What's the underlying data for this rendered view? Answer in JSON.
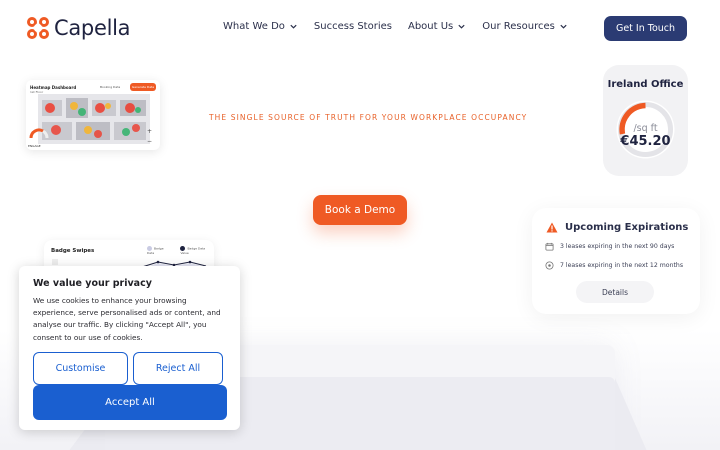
{
  "header": {
    "brand": "Capella",
    "nav": [
      {
        "label": "What We Do",
        "has_dropdown": true
      },
      {
        "label": "Success Stories",
        "has_dropdown": false
      },
      {
        "label": "About Us",
        "has_dropdown": true
      },
      {
        "label": "Our Resources",
        "has_dropdown": true
      }
    ],
    "cta_label": "Get In Touch"
  },
  "hero": {
    "tagline": "THE SINGLE SOURCE OF TRUTH FOR YOUR WORKPLACE OCCUPANCY",
    "demo_label": "Book a Demo"
  },
  "heatmap_card": {
    "title": "Heatmap Dashboard",
    "subtitle": "1st Floor",
    "booking_label": "Booking Data",
    "button_label": "Generate Data",
    "gauge_label": "ENGAGE",
    "zoom_in": "+",
    "zoom_out": "−"
  },
  "ireland_card": {
    "title": "Ireland Office",
    "unit": "/sq ft",
    "price": "€45.20"
  },
  "expirations_card": {
    "title": "Upcoming Expirations",
    "rows": [
      {
        "icon": "calendar-icon",
        "text": "3 leases expiring in the next 90 days"
      },
      {
        "icon": "location-pin-icon",
        "text": "7 leases expiring in the next 12 months"
      }
    ],
    "details_label": "Details"
  },
  "badge_card": {
    "title": "Badge Swipes",
    "legend": [
      "Badge Data",
      "Badge Data Value"
    ]
  },
  "cookie": {
    "title": "We value your privacy",
    "body": "We use cookies to enhance your browsing experience, serve personalised ads or content, and analyse our traffic. By clicking \"Accept All\", you consent to our use of cookies.",
    "customise_label": "Customise",
    "reject_label": "Reject All",
    "accept_label": "Accept All"
  },
  "colors": {
    "brand_orange": "#ef5a24",
    "navy": "#2b3b73",
    "cookie_blue": "#1a5fd0"
  }
}
